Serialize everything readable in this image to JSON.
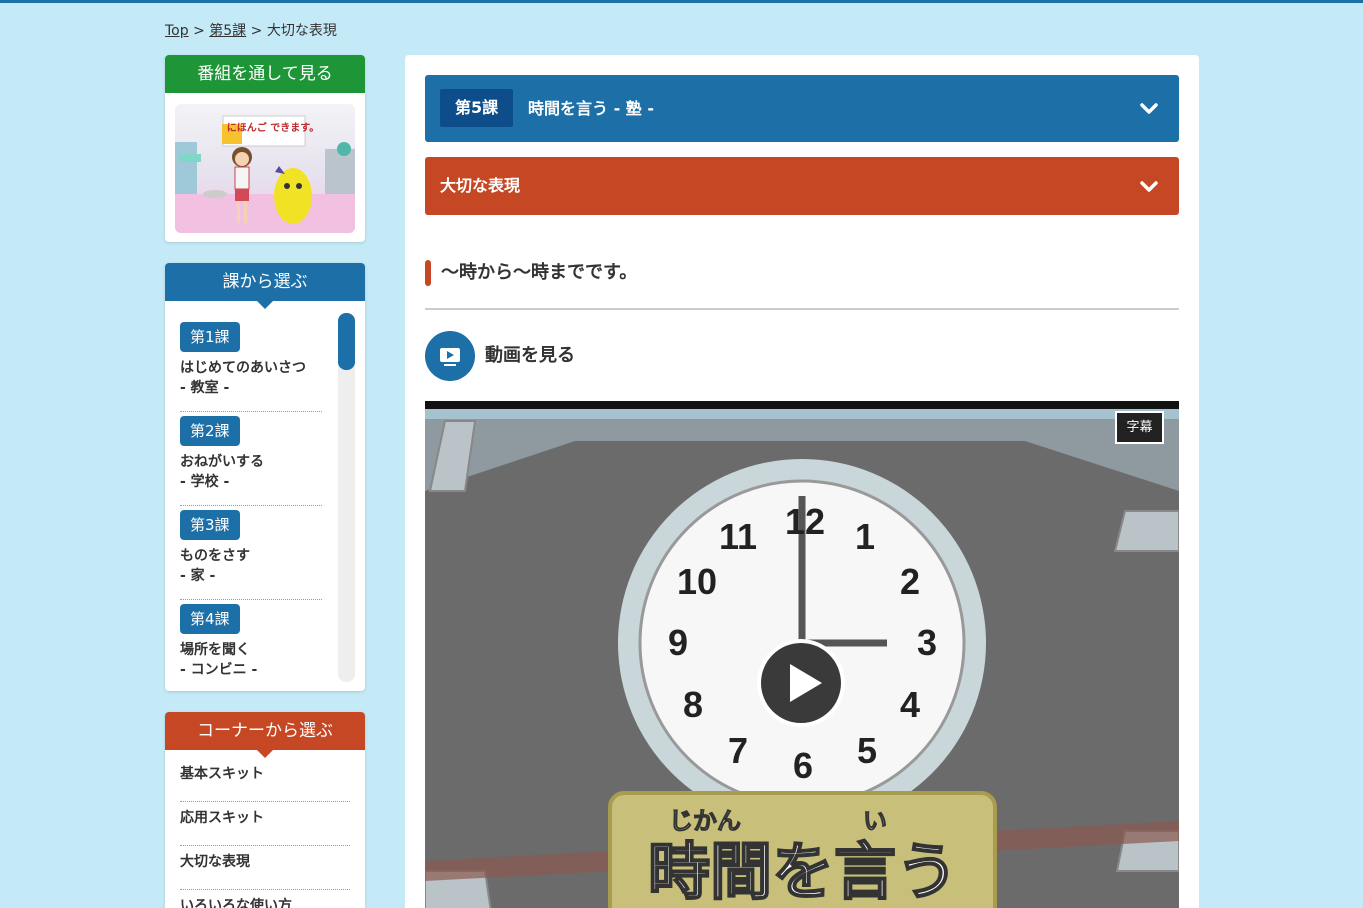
{
  "breadcrumb": {
    "top": "Top",
    "sep1": ">",
    "lesson": "第5課",
    "sep2": ">",
    "current": "大切な表現"
  },
  "sidebar": {
    "program_heading": "番組を通して見る",
    "program_thumb_logo": "にほんご できます。",
    "lessons_heading": "課から選ぶ",
    "lessons": [
      {
        "badge": "第1課",
        "title": "はじめてのあいさつ",
        "place": "- 教室 -"
      },
      {
        "badge": "第2課",
        "title": "おねがいする",
        "place": "- 学校 -"
      },
      {
        "badge": "第3課",
        "title": "ものをさす",
        "place": "- 家 -"
      },
      {
        "badge": "第4課",
        "title": "場所を聞く",
        "place": "- コンビニ -"
      }
    ],
    "corners_heading": "コーナーから選ぶ",
    "corners": [
      "基本スキット",
      "応用スキット",
      "大切な表現",
      "いろいろな使い方"
    ]
  },
  "main": {
    "lesson_badge": "第5課",
    "lesson_title": "時間を言う - 塾 -",
    "corner_title": "大切な表現",
    "section_title": "〜時から〜時までです。",
    "video_label": "動画を見る",
    "video": {
      "subtitles_button": "字幕",
      "caption_ruby_1": "じかん",
      "caption_ruby_2": "い",
      "caption_text": "時間を言う",
      "clock_numbers": [
        "12",
        "1",
        "2",
        "3",
        "4",
        "5",
        "6",
        "7",
        "8",
        "9",
        "10",
        "11"
      ]
    }
  },
  "colors": {
    "blue": "#1d6fa8",
    "red": "#c54724",
    "green": "#1e9638",
    "background": "#c5eaf7"
  },
  "icons": {
    "accordion": "chevron-down-icon",
    "video": "monitor-play-icon",
    "play": "play-icon"
  }
}
